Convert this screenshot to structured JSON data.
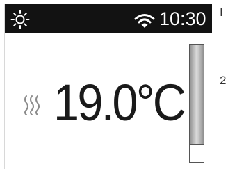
{
  "status_bar": {
    "time": "10:30",
    "icons": [
      "sun-icon",
      "wifi-icon"
    ],
    "background": "#121212",
    "foreground": "#ffffff"
  },
  "main": {
    "temperature": "19.0°C",
    "heating_icon": "heat-waves-icon"
  },
  "level_bar": {
    "fill_fraction": 0.85
  },
  "side_labels": [
    "I",
    "2"
  ]
}
